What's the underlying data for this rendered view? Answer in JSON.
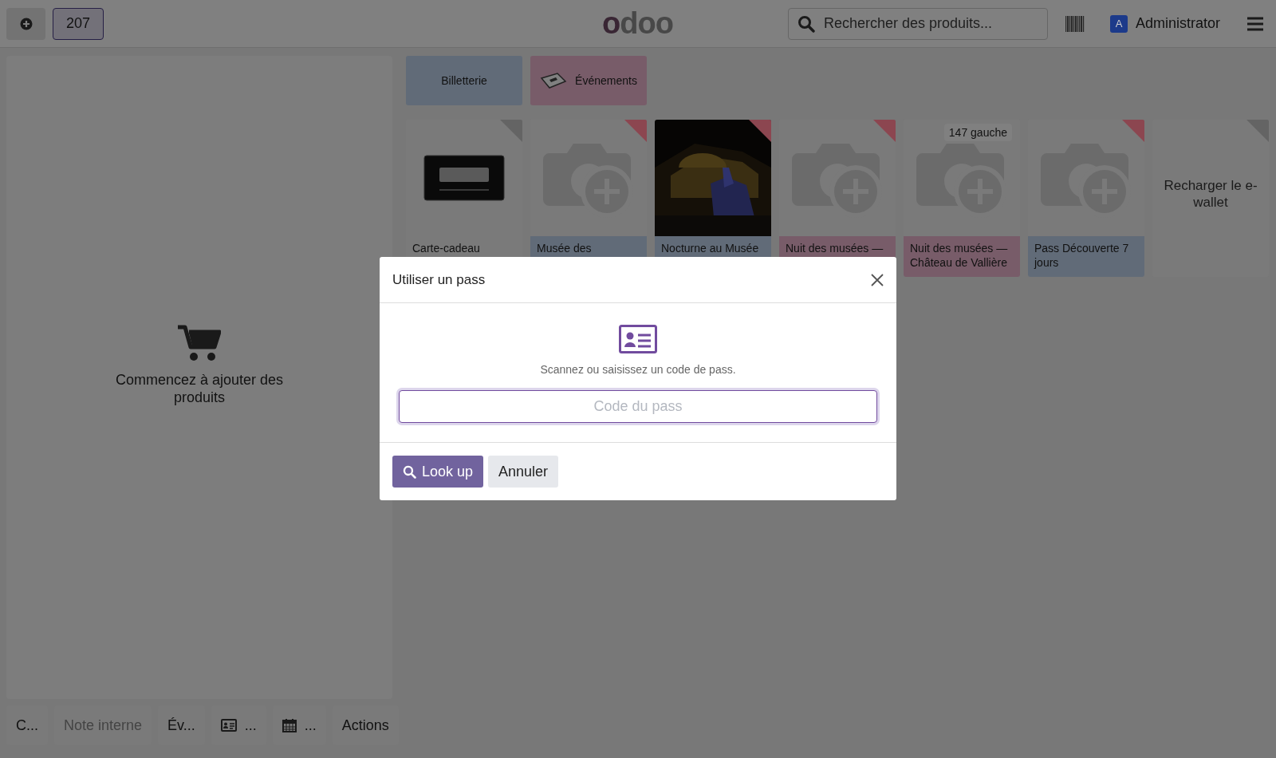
{
  "topbar": {
    "order_count": "207",
    "order_selected": true,
    "logo": "odoo",
    "search": {
      "placeholder": "Rechercher des produits..."
    },
    "user": {
      "initial": "A",
      "name": "Administrator"
    }
  },
  "cart": {
    "empty_text": "Commencez à ajouter des produits"
  },
  "control_buttons": [
    {
      "kind": "text",
      "label": "C...",
      "disabled": false
    },
    {
      "kind": "text",
      "label": "Note interne",
      "disabled": true
    },
    {
      "kind": "text",
      "label": "Év...",
      "disabled": false
    },
    {
      "kind": "idcard",
      "label": "...",
      "disabled": false
    },
    {
      "kind": "calendar",
      "label": "...",
      "disabled": false
    },
    {
      "kind": "text",
      "label": "Actions",
      "disabled": false
    }
  ],
  "categories": [
    {
      "label": "Billetterie",
      "color": "#616b78",
      "icon": false
    },
    {
      "label": "Événements",
      "color": "#785c69",
      "icon": true
    }
  ],
  "products": [
    {
      "name": "Carte-cadeau",
      "kind": "gift",
      "color": "#7a7a7a",
      "warning": false
    },
    {
      "name": "Musée des",
      "kind": "camera",
      "color": "#616b78",
      "warning": true
    },
    {
      "name": "Nocturne au Musée",
      "kind": "picture",
      "color": "#616b78",
      "warning": true
    },
    {
      "name": "Nuit des musées —",
      "kind": "camera",
      "color": "#785c69",
      "warning": true
    },
    {
      "name": "Nuit des musées — Château de Vallière",
      "kind": "camera",
      "color": "#785c69",
      "badge": "147 gauche"
    },
    {
      "name": "Pass Découverte 7 jours",
      "kind": "camera",
      "color": "#616b78",
      "warning": true
    },
    {
      "name": "Recharger le e-wallet",
      "kind": "none",
      "warning": false
    }
  ],
  "dialog": {
    "title": "Utiliser un pass",
    "message": "Scannez ou saisissez un code de pass.",
    "input": {
      "placeholder": "Code du pass"
    },
    "buttons": [
      {
        "kind": "primary",
        "label": "Look up"
      },
      {
        "kind": "secondary",
        "label": "Annuler"
      }
    ]
  }
}
